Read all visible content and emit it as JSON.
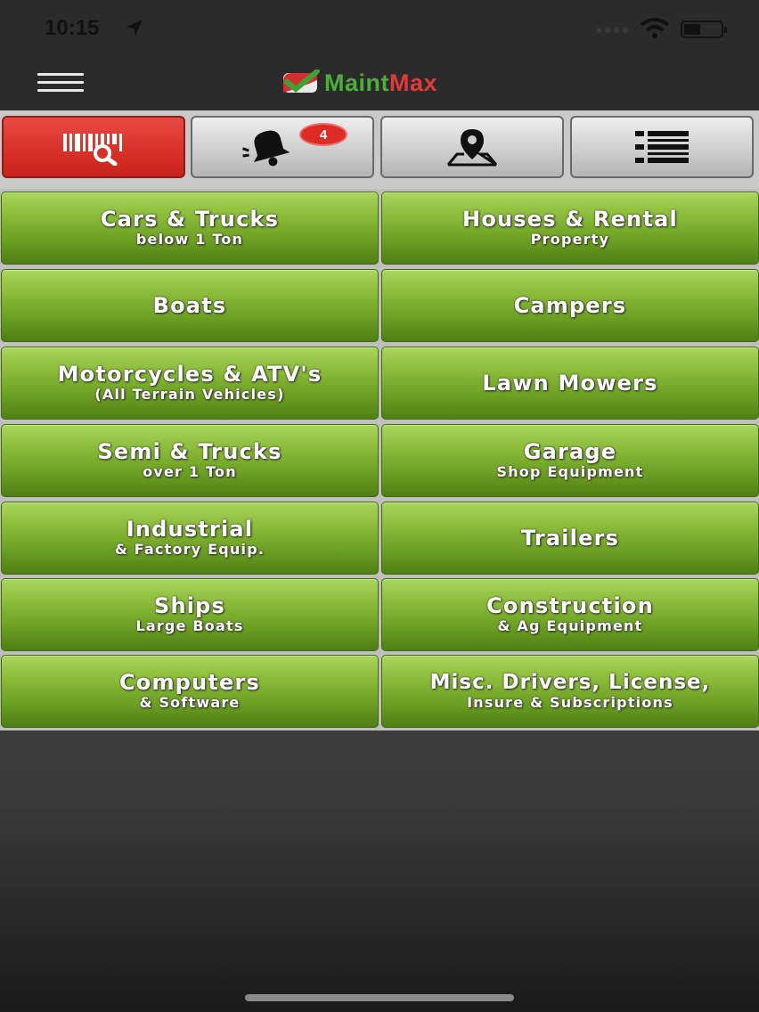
{
  "status": {
    "time": "10:15"
  },
  "header": {
    "logo_part1": "Maint",
    "logo_part2": "Max"
  },
  "tabs": [
    {
      "name": "scan-search",
      "icon": "barcode-search-icon"
    },
    {
      "name": "notifications",
      "icon": "bell-icon",
      "badge": "4"
    },
    {
      "name": "location",
      "icon": "map-pin-icon"
    },
    {
      "name": "list",
      "icon": "list-icon"
    }
  ],
  "categories": [
    {
      "title": "Cars & Trucks",
      "sub": "below 1 Ton"
    },
    {
      "title": "Houses & Rental",
      "sub": "Property"
    },
    {
      "title": "Boats",
      "sub": ""
    },
    {
      "title": "Campers",
      "sub": ""
    },
    {
      "title": "Motorcycles & ATV's",
      "sub": "(All Terrain Vehicles)"
    },
    {
      "title": "Lawn Mowers",
      "sub": ""
    },
    {
      "title": "Semi & Trucks",
      "sub": "over 1 Ton"
    },
    {
      "title": "Garage",
      "sub": "Shop Equipment"
    },
    {
      "title": "Industrial",
      "sub": "& Factory Equip."
    },
    {
      "title": "Trailers",
      "sub": ""
    },
    {
      "title": "Ships",
      "sub": "Large Boats"
    },
    {
      "title": "Construction",
      "sub": "& Ag Equipment"
    },
    {
      "title": "Computers",
      "sub": "& Software"
    },
    {
      "title": "Misc. Drivers, License,",
      "sub": "Insure & Subscriptions"
    }
  ],
  "colors": {
    "active_tab": "#d73028",
    "category_green": "#6ea224",
    "logo_green": "#4caf3a",
    "logo_red": "#e03a3a"
  }
}
